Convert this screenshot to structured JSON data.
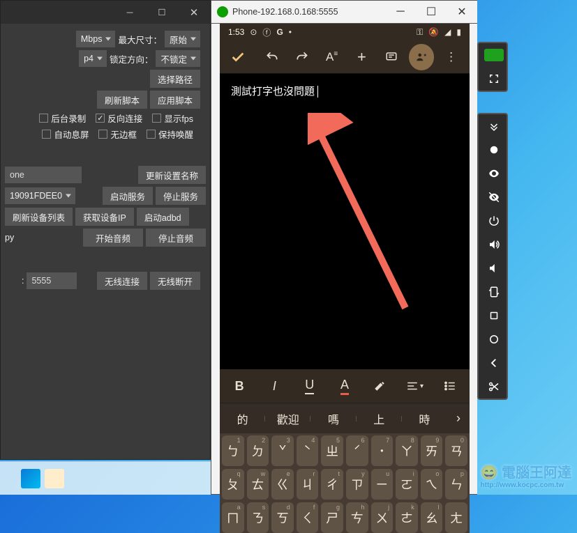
{
  "left_window": {
    "bitrate_unit": "Mbps",
    "max_size_label": "最大尺寸：",
    "max_size_value": "原始",
    "fmt_value": "p4",
    "lock_orient_label": "锁定方向：",
    "lock_orient_value": "不锁定",
    "choose_path_btn": "选择路径",
    "refresh_script_btn": "刷新脚本",
    "apply_script_btn": "应用脚本",
    "chk_bg_record": "后台录制",
    "chk_reverse": "反向连接",
    "chk_show_fps": "显示fps",
    "chk_auto_sleep": "自动息屏",
    "chk_no_border": "无边框",
    "chk_keep_awake": "保持唤醒",
    "device_name_value": "one",
    "update_name_btn": "更新设置名称",
    "serial_value": "19091FDEE0",
    "start_service_btn": "启动服务",
    "stop_service_btn": "停止服务",
    "refresh_list_btn": "刷新设备列表",
    "get_ip_btn": "获取设备IP",
    "start_adbd_btn": "启动adbd",
    "py_label": "py",
    "start_audio_btn": "开始音频",
    "stop_audio_btn": "停止音频",
    "port_value": "5555",
    "wifi_connect_btn": "无线连接",
    "wifi_disconnect_btn": "无线断开"
  },
  "phone_window": {
    "title": "Phone-192.168.0.168:5555",
    "status_time": "1:53",
    "document_text": "測試打字也沒問題",
    "suggestions": [
      "的",
      "歡迎",
      "嗎",
      "上",
      "時"
    ],
    "keyboard_rows": [
      [
        {
          "main": "ㄅ",
          "hint": "1"
        },
        {
          "main": "ㄉ",
          "hint": "2"
        },
        {
          "main": "ˇ",
          "hint": "3"
        },
        {
          "main": "ˋ",
          "hint": "4"
        },
        {
          "main": "ㄓ",
          "hint": "5"
        },
        {
          "main": "ˊ",
          "hint": "6"
        },
        {
          "main": "˙",
          "hint": "7"
        },
        {
          "main": "ㄚ",
          "hint": "8"
        },
        {
          "main": "ㄞ",
          "hint": "9"
        },
        {
          "main": "ㄢ",
          "hint": "0"
        }
      ],
      [
        {
          "main": "ㄆ",
          "hint": "q"
        },
        {
          "main": "ㄊ",
          "hint": "w"
        },
        {
          "main": "ㄍ",
          "hint": "e"
        },
        {
          "main": "ㄐ",
          "hint": "r"
        },
        {
          "main": "ㄔ",
          "hint": "t"
        },
        {
          "main": "ㄗ",
          "hint": "y"
        },
        {
          "main": "ㄧ",
          "hint": "u"
        },
        {
          "main": "ㄛ",
          "hint": "i"
        },
        {
          "main": "ㄟ",
          "hint": "o"
        },
        {
          "main": "ㄣ",
          "hint": "p"
        }
      ],
      [
        {
          "main": "ㄇ",
          "hint": "a"
        },
        {
          "main": "ㄋ",
          "hint": "s"
        },
        {
          "main": "ㄎ",
          "hint": "d"
        },
        {
          "main": "ㄑ",
          "hint": "f"
        },
        {
          "main": "ㄕ",
          "hint": "g"
        },
        {
          "main": "ㄘ",
          "hint": "h"
        },
        {
          "main": "ㄨ",
          "hint": "j"
        },
        {
          "main": "ㄜ",
          "hint": "k"
        },
        {
          "main": "ㄠ",
          "hint": "l"
        },
        {
          "main": "ㄤ",
          "hint": ""
        }
      ]
    ]
  },
  "watermark": {
    "main": "電腦王阿達",
    "sub": "http://www.kocpc.com.tw"
  }
}
